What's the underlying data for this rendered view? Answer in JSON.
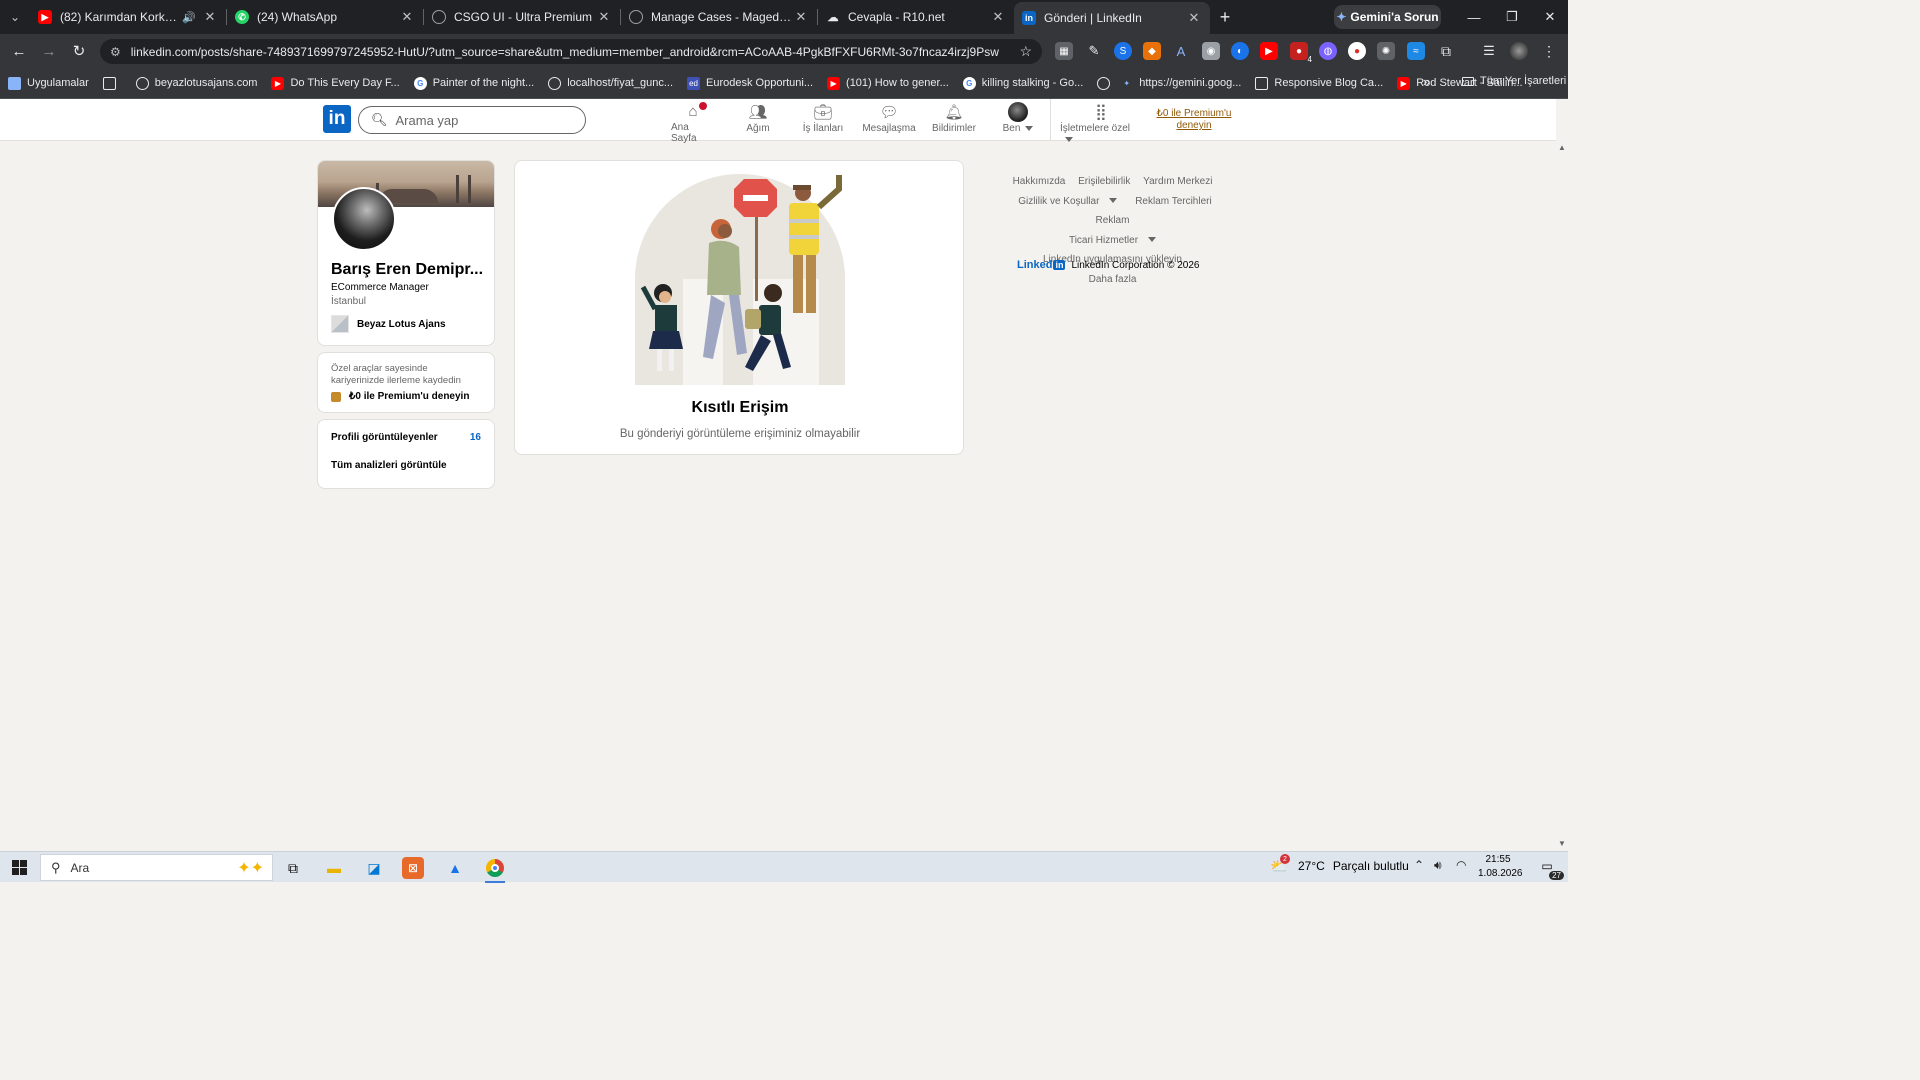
{
  "browser": {
    "tabs": [
      {
        "title": "(82) Karımdan Korkmuyorum",
        "favicon": "youtube-icon",
        "color": "#ff0000",
        "audio": true,
        "active": false
      },
      {
        "title": "(24) WhatsApp",
        "favicon": "whatsapp-icon",
        "color": "#25d366",
        "audio": false,
        "active": false
      },
      {
        "title": "CSGO UI - Ultra Premium",
        "favicon": "globe-icon",
        "color": "#9aa0a6",
        "audio": false,
        "active": false
      },
      {
        "title": "Manage Cases - Maged.gg",
        "favicon": "globe-icon",
        "color": "#9aa0a6",
        "audio": false,
        "active": false
      },
      {
        "title": "Cevapla - R10.net",
        "favicon": "r10-icon",
        "color": "#e8eaed",
        "audio": false,
        "active": false
      },
      {
        "title": "Gönderi | LinkedIn",
        "favicon": "linkedin-icon",
        "color": "#0a66c2",
        "audio": false,
        "active": true
      }
    ],
    "gemini_label": "Gemini'a Sorun",
    "url": "linkedin.com/posts/share-7489371699797245952-HutU/?utm_source=share&utm_medium=member_android&rcm=ACoAAB-4PgkBfFXFU6RMt-3o7fncaz4irzj9Psw",
    "extension_badge": "4",
    "bookmarks": [
      {
        "label": "Uygulamalar",
        "icon": "apps-icon"
      },
      {
        "label": "beyazlotusajans.com",
        "icon": "globe-icon"
      },
      {
        "label": "Do This Every Day F...",
        "icon": "youtube-icon"
      },
      {
        "label": "Painter of the night...",
        "icon": "google-icon"
      },
      {
        "label": "localhost/fiyat_gunc...",
        "icon": "globe-icon"
      },
      {
        "label": "Eurodesk Opportuni...",
        "icon": "eurodesk-icon"
      },
      {
        "label": "(101) How to gener...",
        "icon": "youtube-icon"
      },
      {
        "label": "killing stalking - Go...",
        "icon": "google-icon"
      },
      {
        "label": "https://gemini.goog...",
        "icon": "gemini-icon"
      },
      {
        "label": "Responsive Blog Ca...",
        "icon": "codepen-icon"
      },
      {
        "label": "Rod Stewart - Sailin...",
        "icon": "youtube-icon"
      }
    ],
    "all_bookmarks_label": "Tüm Yer İşaretleri"
  },
  "linkedin": {
    "logo_text": "in",
    "search_placeholder": "Arama yap",
    "nav": [
      {
        "label": "Ana Sayfa",
        "icon": "home-icon"
      },
      {
        "label": "Ağım",
        "icon": "network-icon"
      },
      {
        "label": "İş İlanları",
        "icon": "briefcase-icon"
      },
      {
        "label": "Mesajlaşma",
        "icon": "messaging-icon"
      },
      {
        "label": "Bildirimler",
        "icon": "bell-icon"
      },
      {
        "label": "Ben",
        "icon": "avatar"
      },
      {
        "label": "İşletmelere özel",
        "icon": "grid-icon"
      }
    ],
    "premium_link": "₺0 ile Premium'u deneyin",
    "profile": {
      "name": "Barış Eren Demipr...",
      "headline": "ECommerce Manager",
      "location": "İstanbul",
      "company": "Beyaz Lotus Ajans"
    },
    "premium_card": {
      "text": "Özel araçlar sayesinde kariyerinizde ilerleme kaydedin",
      "cta": "₺0 ile Premium'u deneyin"
    },
    "stats": {
      "viewers_label": "Profili görüntüleyenler",
      "viewers_count": "16",
      "analytics_label": "Tüm analizleri görüntüle"
    },
    "restricted": {
      "title": "Kısıtlı Erişim",
      "subtitle": "Bu gönderiyi görüntüleme erişiminiz olmayabilir"
    },
    "footer": {
      "links": [
        "Hakkımızda",
        "Erişilebilirlik",
        "Yardım Merkezi",
        "Gizlilik ve Koşullar",
        "Reklam Tercihleri",
        "Reklam",
        "Ticari Hizmetler",
        "LinkedIn uygulamasını yükleyin",
        "Daha fazla"
      ],
      "brand": "Linked",
      "brand_in": "in",
      "copyright": "LinkedIn Corporation © 2026"
    }
  },
  "taskbar": {
    "search_placeholder": "Ara",
    "weather_temp": "27°C",
    "weather_text": "Parçalı bulutlu",
    "weather_badge": "2",
    "time": "21:55",
    "date": "1.08.2026",
    "notification_count": "27"
  },
  "colors": {
    "linkedin_blue": "#0a66c2",
    "premium_gold": "#915907",
    "chrome_dark": "#202124",
    "chrome_toolbar": "#35363a"
  }
}
